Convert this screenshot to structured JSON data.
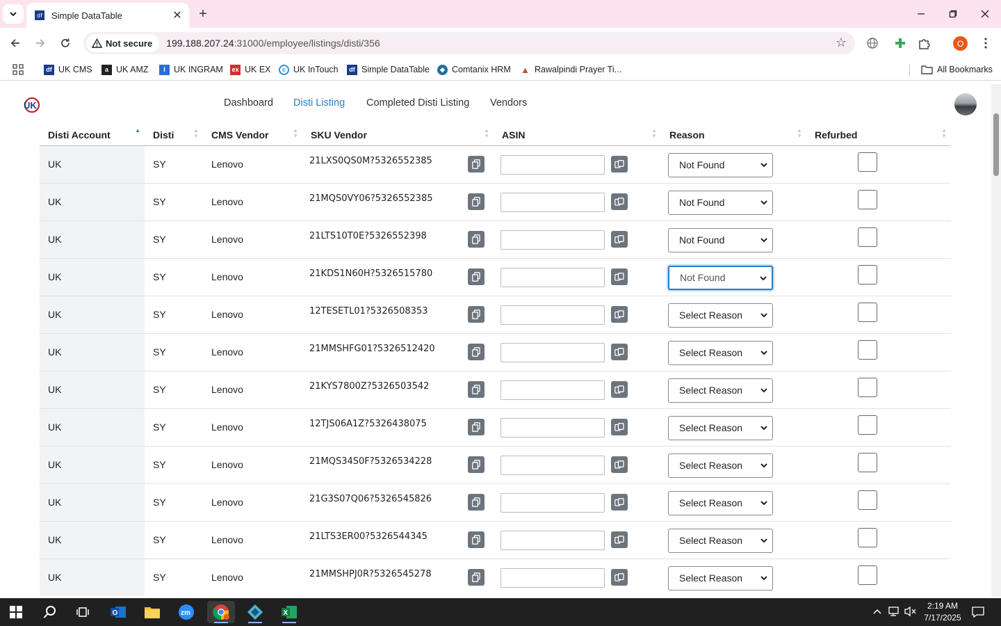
{
  "browser": {
    "tab_title": "Simple DataTable",
    "security_label": "Not secure",
    "url_host": "199.188.207.24",
    "url_rest": ":31000/employee/listings/disti/356",
    "profile_initial": "O",
    "bookmarks": [
      {
        "label": "UK CMS",
        "icon": "uk-cms-icon",
        "color": "#1a3c8c"
      },
      {
        "label": "UK AMZ",
        "icon": "amazon-icon",
        "color": "#222222"
      },
      {
        "label": "UK INGRAM",
        "icon": "ingram-icon",
        "color": "#2a6fd0"
      },
      {
        "label": "UK EX",
        "icon": "ex-icon",
        "color": "#d32f2f"
      },
      {
        "label": "UK InTouch",
        "icon": "intouch-icon",
        "color": "#2a8fd0"
      },
      {
        "label": "Simple DataTable",
        "icon": "datatable-icon",
        "color": "#1a3c8c"
      },
      {
        "label": "Comtanix HRM",
        "icon": "comtanix-icon",
        "color": "#1f6f9f"
      },
      {
        "label": "Rawalpindi Prayer Ti...",
        "icon": "prayer-icon",
        "color": "#6a3a2a"
      }
    ],
    "all_bookmarks_label": "All Bookmarks"
  },
  "nav": {
    "links": [
      "Dashboard",
      "Disti Listing",
      "Completed Disti Listing",
      "Vendors"
    ],
    "active_index": 1
  },
  "table": {
    "headers": [
      "Disti Account",
      "Disti",
      "CMS Vendor",
      "SKU Vendor",
      "ASIN",
      "Reason",
      "Refurbed"
    ],
    "rows": [
      {
        "account": "UK",
        "disti": "SY",
        "vendor": "Lenovo",
        "sku": "21LXS0QS0M?5326552385",
        "asin": "",
        "reason": "Not Found",
        "refurbed": false
      },
      {
        "account": "UK",
        "disti": "SY",
        "vendor": "Lenovo",
        "sku": "21MQS0VY06?5326552385",
        "asin": "",
        "reason": "Not Found",
        "refurbed": false
      },
      {
        "account": "UK",
        "disti": "SY",
        "vendor": "Lenovo",
        "sku": "21LTS10T0E?5326552398",
        "asin": "",
        "reason": "Not Found",
        "refurbed": false
      },
      {
        "account": "UK",
        "disti": "SY",
        "vendor": "Lenovo",
        "sku": "21KDS1N60H?5326515780",
        "asin": "",
        "reason": "Not Found",
        "refurbed": false
      },
      {
        "account": "UK",
        "disti": "SY",
        "vendor": "Lenovo",
        "sku": "12TESETL01?5326508353",
        "asin": "",
        "reason": "Select Reason",
        "refurbed": false
      },
      {
        "account": "UK",
        "disti": "SY",
        "vendor": "Lenovo",
        "sku": "21MMSHFG01?5326512420",
        "asin": "",
        "reason": "Select Reason",
        "refurbed": false
      },
      {
        "account": "UK",
        "disti": "SY",
        "vendor": "Lenovo",
        "sku": "21KYS7800Z?5326503542",
        "asin": "",
        "reason": "Select Reason",
        "refurbed": false
      },
      {
        "account": "UK",
        "disti": "SY",
        "vendor": "Lenovo",
        "sku": "12TJS06A1Z?5326438075",
        "asin": "",
        "reason": "Select Reason",
        "refurbed": false
      },
      {
        "account": "UK",
        "disti": "SY",
        "vendor": "Lenovo",
        "sku": "21MQS34S0F?5326534228",
        "asin": "",
        "reason": "Select Reason",
        "refurbed": false
      },
      {
        "account": "UK",
        "disti": "SY",
        "vendor": "Lenovo",
        "sku": "21G3S07Q06?5326545826",
        "asin": "",
        "reason": "Select Reason",
        "refurbed": false
      },
      {
        "account": "UK",
        "disti": "SY",
        "vendor": "Lenovo",
        "sku": "21LTS3ER00?5326544345",
        "asin": "",
        "reason": "Select Reason",
        "refurbed": false
      },
      {
        "account": "UK",
        "disti": "SY",
        "vendor": "Lenovo",
        "sku": "21MMSHPJ0R?5326545278",
        "asin": "",
        "reason": "Select Reason",
        "refurbed": false
      }
    ],
    "focused_row": 3
  },
  "taskbar": {
    "time": "2:19 AM",
    "date": "7/17/2025"
  },
  "colors": {
    "accent": "#2a7fc4",
    "tabstrip": "#fce3ee",
    "copy_button": "#6c757d"
  }
}
